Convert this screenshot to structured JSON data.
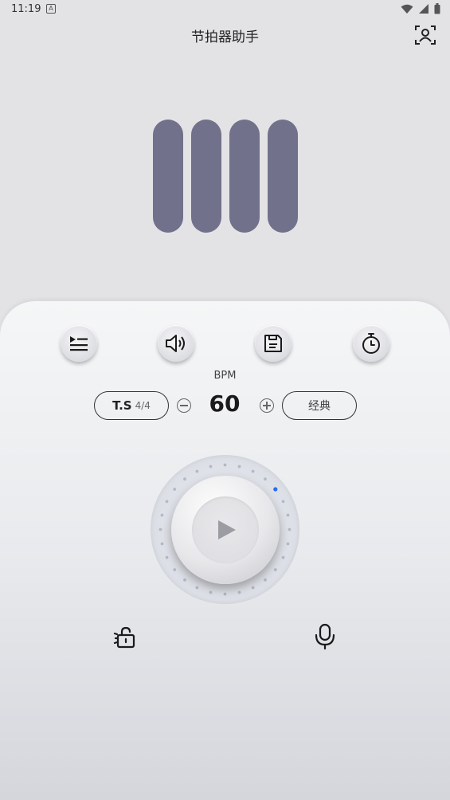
{
  "status_bar": {
    "time": "11:19",
    "notification_badge": "A"
  },
  "header": {
    "title": "节拍器助手",
    "action_icon": "scan-person-icon"
  },
  "beat_indicators": {
    "count": 4,
    "color": "#72718b"
  },
  "toolbar": {
    "buttons": [
      {
        "name": "playlist-button",
        "icon": "playlist-icon"
      },
      {
        "name": "sound-button",
        "icon": "sound-icon"
      },
      {
        "name": "save-button",
        "icon": "save-icon"
      },
      {
        "name": "timer-button",
        "icon": "timer-icon"
      }
    ]
  },
  "tempo": {
    "label": "BPM",
    "value": "60",
    "time_signature_label": "T.S",
    "time_signature_value": "4/4",
    "style": "经典"
  },
  "dial": {
    "active_dot_color": "#2a6cf0",
    "dot_color": "#b4b8c8"
  },
  "bottom": {
    "left_icon": "lock-open-icon",
    "right_icon": "microphone-icon"
  }
}
